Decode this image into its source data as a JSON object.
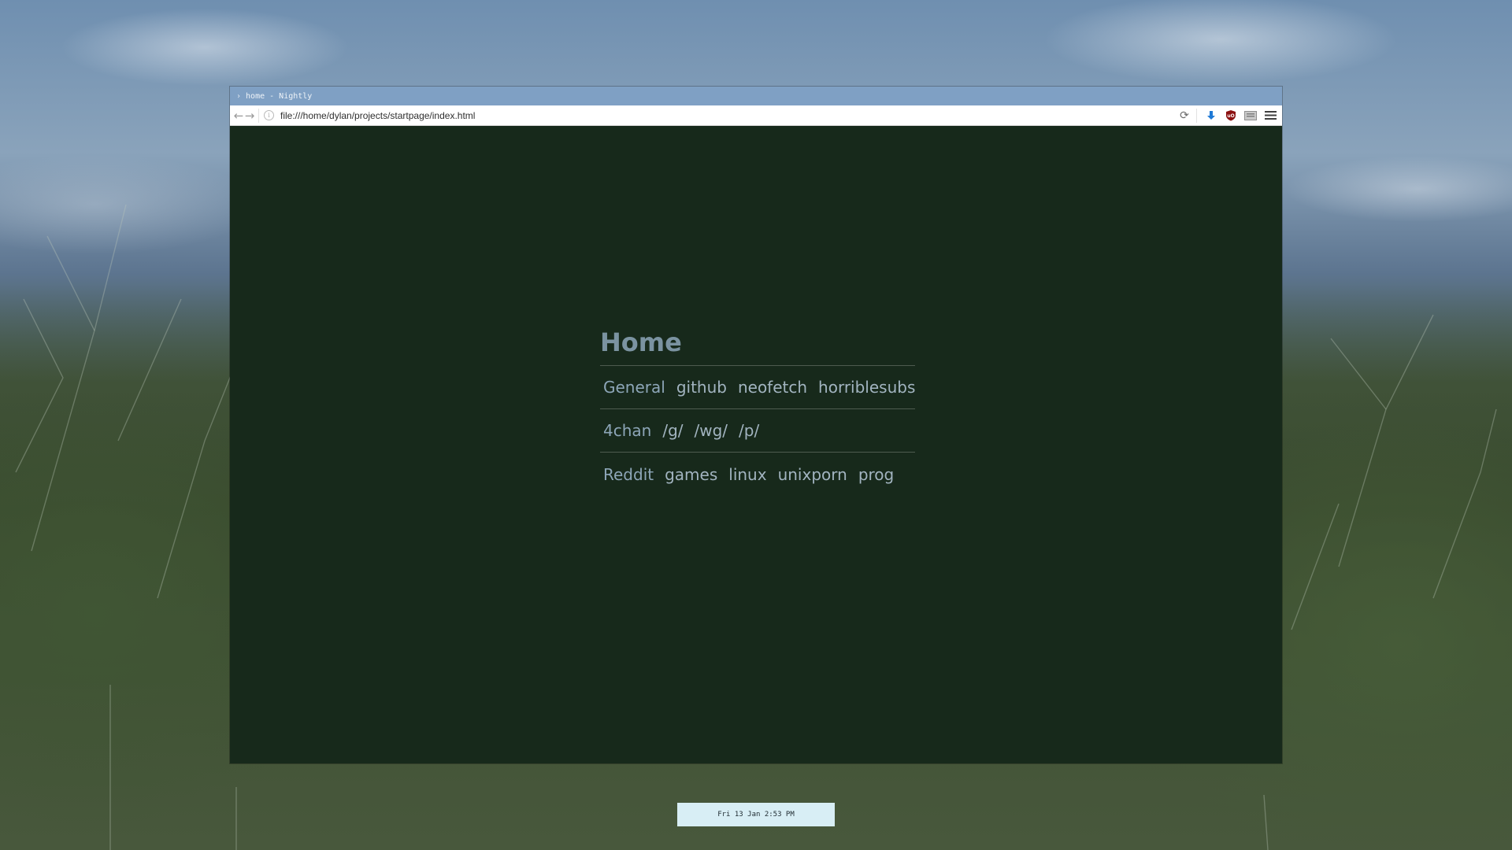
{
  "window": {
    "title": "home - Nightly"
  },
  "toolbar": {
    "url": "file:///home/dylan/projects/startpage/index.html",
    "back_icon": "←",
    "forward_icon": "→",
    "reload_icon": "⟳"
  },
  "startpage": {
    "title": "Home",
    "rows": [
      {
        "category": "General",
        "links": [
          "github",
          "neofetch",
          "horriblesubs"
        ]
      },
      {
        "category": "4chan",
        "links": [
          "/g/",
          "/wg/",
          "/p/"
        ]
      },
      {
        "category": "Reddit",
        "links": [
          "games",
          "linux",
          "unixporn",
          "prog"
        ]
      }
    ]
  },
  "statusbar": {
    "clock": "Fri 13 Jan  2:53 PM"
  },
  "colors": {
    "page_bg": "#17291b",
    "heading": "#7b93a1",
    "link": "#a2b4c0",
    "titlebar": "#7fa0c4",
    "clock_bg": "#d8eef5"
  }
}
